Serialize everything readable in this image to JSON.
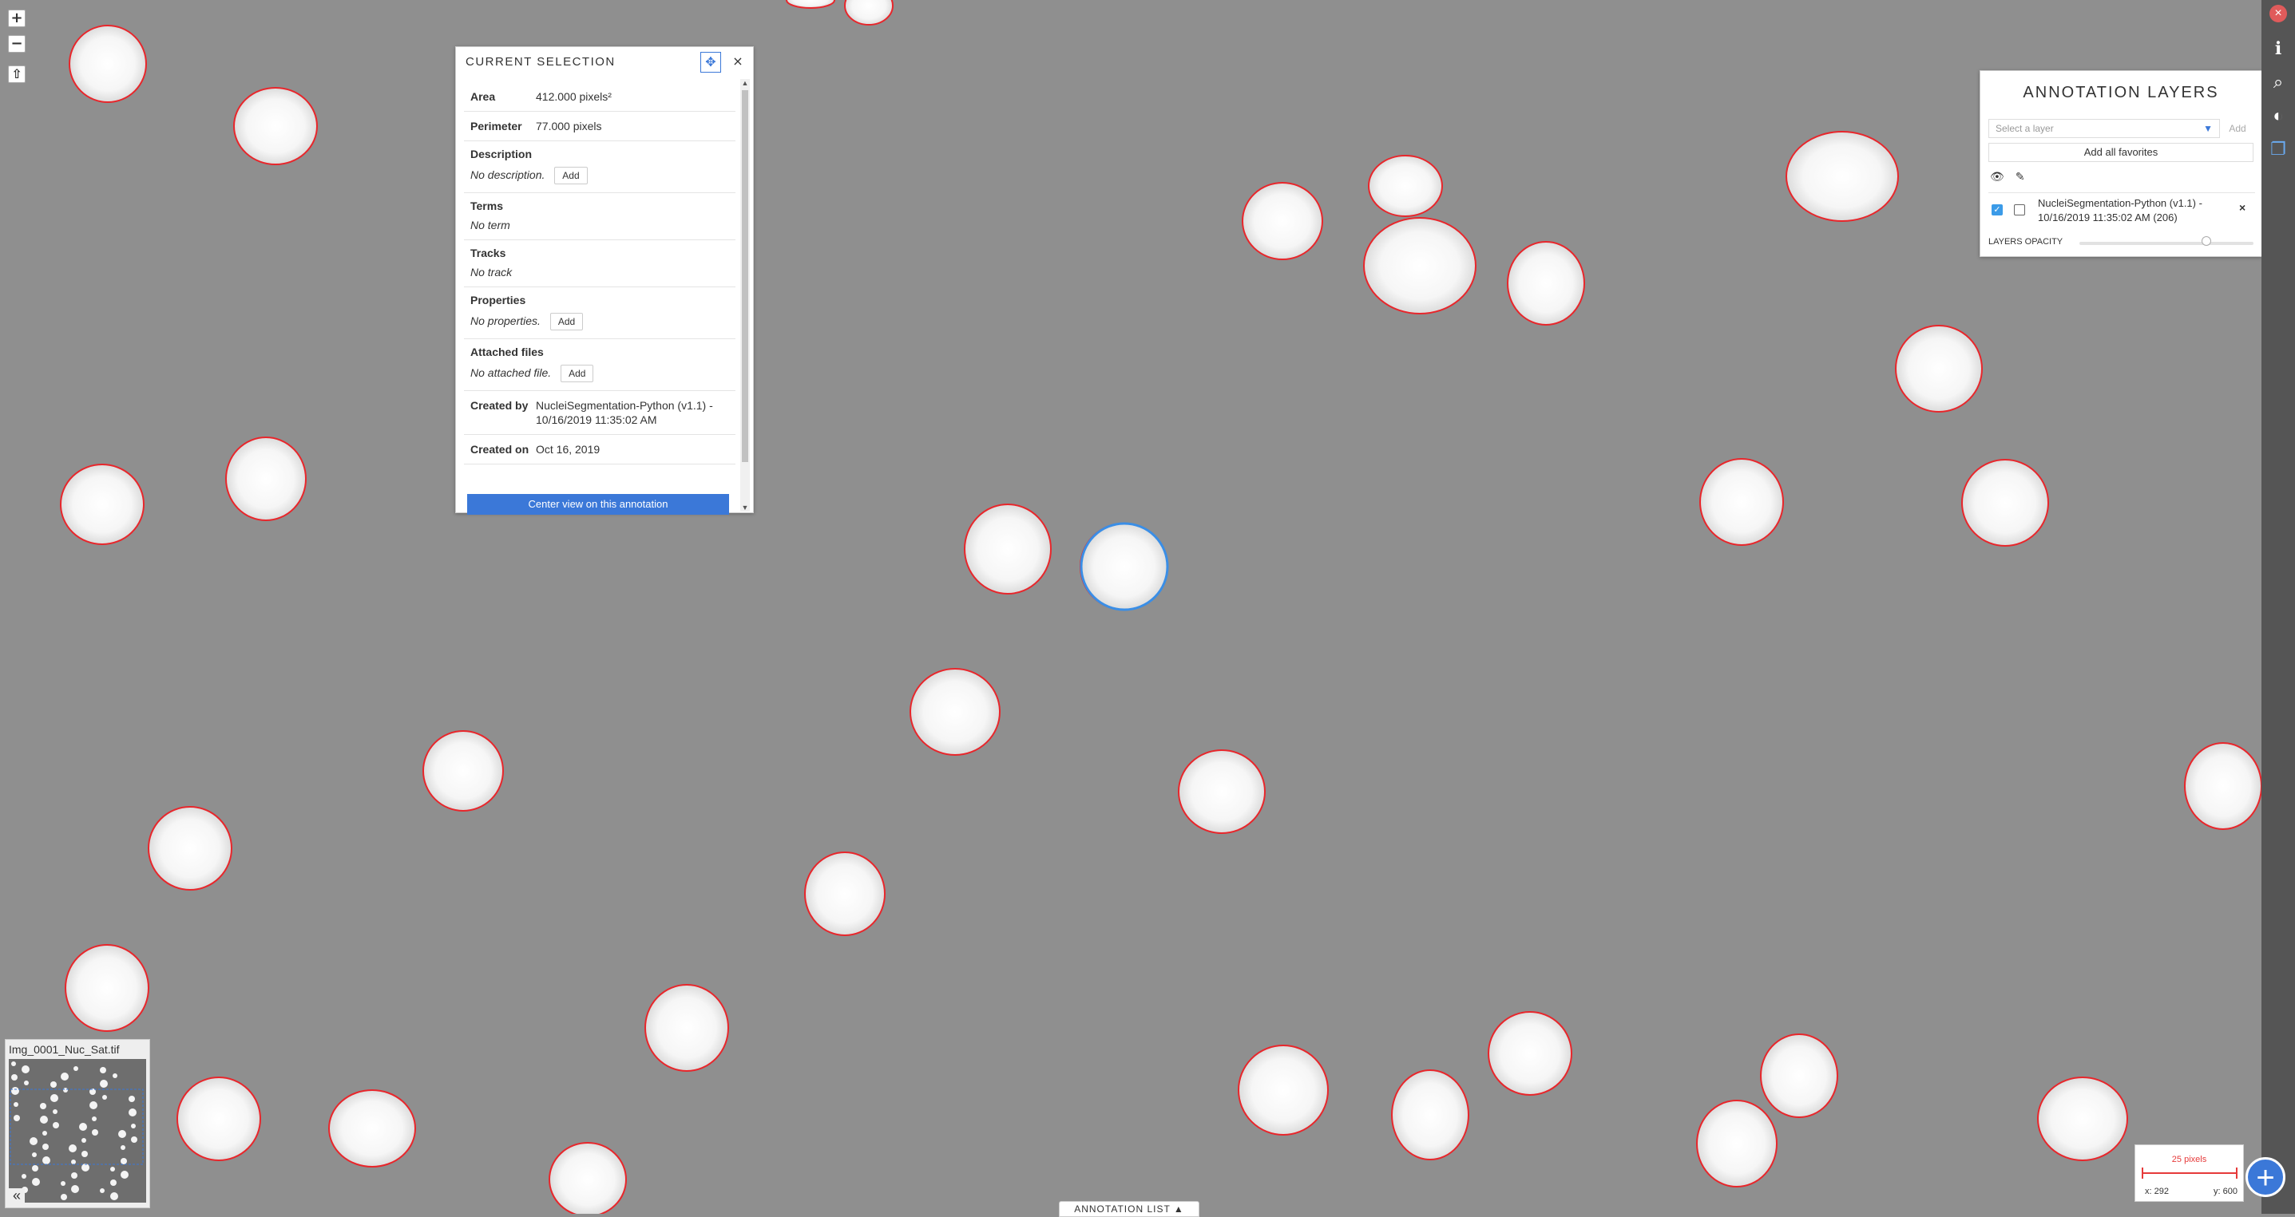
{
  "zoom": {
    "in_label": "+",
    "out_label": "−",
    "rotate_label": "⇧"
  },
  "selection": {
    "title": "CURRENT SELECTION",
    "move_icon": "move-icon",
    "close_label": "×",
    "area_label": "Area",
    "area_value": "412.000 pixels²",
    "perimeter_label": "Perimeter",
    "perimeter_value": "77.000 pixels",
    "description_label": "Description",
    "description_value": "No description.",
    "terms_label": "Terms",
    "terms_value": "No term",
    "tracks_label": "Tracks",
    "tracks_value": "No track",
    "properties_label": "Properties",
    "properties_value": "No properties.",
    "attached_label": "Attached files",
    "attached_value": "No attached file.",
    "add_label": "Add",
    "created_by_label": "Created by",
    "created_by_value": "NucleiSegmentation-Python (v1.1) - 10/16/2019 11:35:02 AM",
    "created_on_label": "Created on",
    "created_on_value": "Oct 16, 2019",
    "center_button": "Center view on this annotation"
  },
  "layers": {
    "title": "ANNOTATION LAYERS",
    "select_placeholder": "Select a layer",
    "add_label": "Add",
    "add_favorites": "Add all favorites",
    "layer_name": "NucleiSegmentation-Python (v1.1) - 10/16/2019 11:35:02 AM (206)",
    "layer_visible": true,
    "opacity_label": "LAYERS OPACITY",
    "opacity_value": 0.85
  },
  "right_toolbar": [
    "close-icon",
    "info-icon",
    "search-icon",
    "contrast-icon",
    "copy-icon"
  ],
  "overview": {
    "image_name": "Img_0001_Nuc_Sat.tif",
    "collapse_label": "«"
  },
  "annotation_list_label": "ANNOTATION LIST ▲",
  "scale": {
    "label": "25 pixels",
    "x": "x: 292",
    "y": "y: 600"
  },
  "colors": {
    "annotation": "#e8262b",
    "selected": "#3a8ee6",
    "accent": "#3b78d8",
    "background": "#8f8f8f"
  }
}
